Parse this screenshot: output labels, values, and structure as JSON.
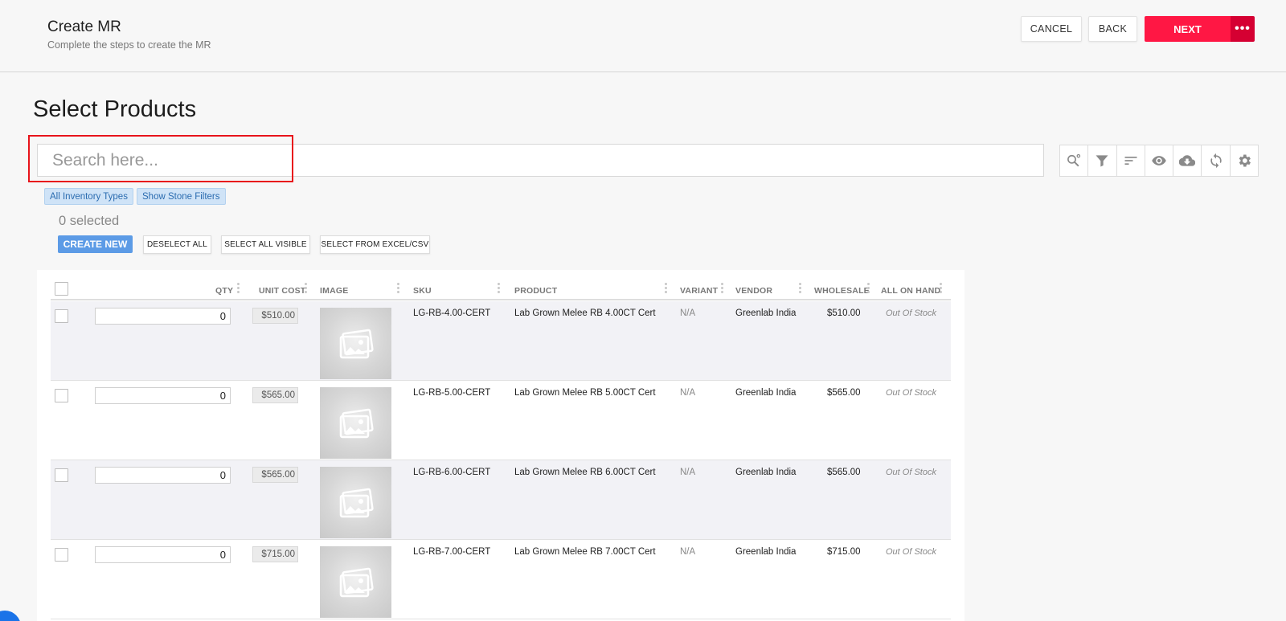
{
  "header": {
    "title": "Create MR",
    "subtitle": "Complete the steps to create the MR",
    "cancel_label": "CANCEL",
    "back_label": "BACK",
    "next_label": "NEXT",
    "more_label": "•••"
  },
  "page": {
    "title": "Select Products"
  },
  "search": {
    "placeholder": "Search here..."
  },
  "toolbar": {
    "icons": [
      "search-settings-icon",
      "filter-icon",
      "sort-icon",
      "eye-icon",
      "cloud-download-icon",
      "refresh-icon",
      "gear-icon"
    ]
  },
  "filters": {
    "inventory_types": "All Inventory Types",
    "stone_filters": "Show Stone Filters"
  },
  "selection": {
    "count_text": "0 selected",
    "create_new": "CREATE NEW",
    "deselect_all": "DESELECT ALL",
    "select_all_visible": "SELECT ALL VISIBLE",
    "select_from_excel": "SELECT FROM EXCEL/CSV"
  },
  "grid": {
    "columns": {
      "qty": "QTY",
      "unit_cost": "UNIT COST",
      "image": "IMAGE",
      "sku": "SKU",
      "product": "PRODUCT",
      "variant": "VARIANT",
      "vendor": "VENDOR",
      "wholesale": "WHOLESALE",
      "all_on_hand": "ALL ON HAND"
    },
    "rows": [
      {
        "qty": "0",
        "unit_cost": "$510.00",
        "sku": "LG-RB-4.00-CERT",
        "product": "Lab Grown Melee RB 4.00CT Cert",
        "variant": "N/A",
        "vendor": "Greenlab India",
        "wholesale": "$510.00",
        "on_hand": "Out Of Stock"
      },
      {
        "qty": "0",
        "unit_cost": "$565.00",
        "sku": "LG-RB-5.00-CERT",
        "product": "Lab Grown Melee RB 5.00CT Cert",
        "variant": "N/A",
        "vendor": "Greenlab India",
        "wholesale": "$565.00",
        "on_hand": "Out Of Stock"
      },
      {
        "qty": "0",
        "unit_cost": "$565.00",
        "sku": "LG-RB-6.00-CERT",
        "product": "Lab Grown Melee RB 6.00CT Cert",
        "variant": "N/A",
        "vendor": "Greenlab India",
        "wholesale": "$565.00",
        "on_hand": "Out Of Stock"
      },
      {
        "qty": "0",
        "unit_cost": "$715.00",
        "sku": "LG-RB-7.00-CERT",
        "product": "Lab Grown Melee RB 7.00CT Cert",
        "variant": "N/A",
        "vendor": "Greenlab India",
        "wholesale": "$715.00",
        "on_hand": "Out Of Stock"
      }
    ]
  },
  "colors": {
    "primary_action": "#ff1744",
    "primary_action_dark": "#d50032",
    "create_new": "#5c9be6",
    "chip_bg": "#cfe3f7",
    "highlight_box": "#e8141b"
  }
}
